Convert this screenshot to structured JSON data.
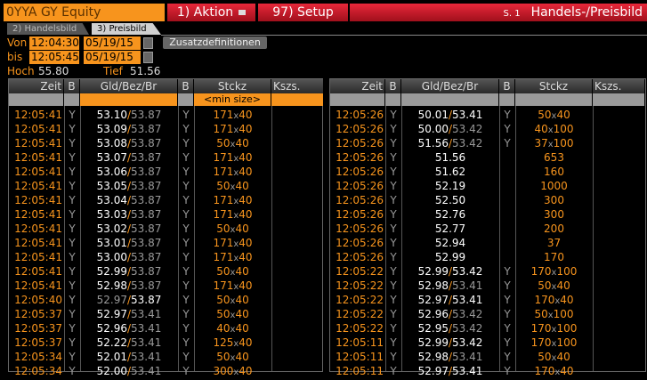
{
  "header": {
    "ticker": "0YYA GY Equity",
    "aktion": "1) Aktion",
    "setup": "97) Setup",
    "page": "S. 1",
    "title": "Handels-/Preisbild"
  },
  "tabs": [
    {
      "label": "2) Handelsbild"
    },
    {
      "label": "3) Preisbild"
    }
  ],
  "filters": {
    "von_label": "Von",
    "von_time": "12:04:30",
    "von_date": "05/19/15",
    "bis_label": "bis",
    "bis_time": "12:05:45",
    "bis_date": "05/19/15",
    "zusatz": "Zusatzdefinitionen",
    "hoch_label": "Hoch",
    "hoch": "55.80",
    "tief_label": "Tief",
    "tief": "51.56"
  },
  "columns": {
    "zeit": "Zeit",
    "b": "B",
    "gld": "Gld/Bez/Br",
    "b2": "B",
    "stckz": "Stckz",
    "kszs": "Kszs.",
    "min_size": "<min size>"
  },
  "left_rows": [
    {
      "t": "12:05:41",
      "b": "Y",
      "bid": "53.10",
      "ask": "53.87",
      "hi": "bid",
      "b2": "Y",
      "s1": "171",
      "s2": "40"
    },
    {
      "t": "12:05:41",
      "b": "Y",
      "bid": "53.09",
      "ask": "53.87",
      "hi": "bid",
      "b2": "Y",
      "s1": "171",
      "s2": "40"
    },
    {
      "t": "12:05:41",
      "b": "Y",
      "bid": "53.08",
      "ask": "53.87",
      "hi": "bid",
      "b2": "Y",
      "s1": "50",
      "s2": "40"
    },
    {
      "t": "12:05:41",
      "b": "Y",
      "bid": "53.07",
      "ask": "53.87",
      "hi": "bid",
      "b2": "Y",
      "s1": "171",
      "s2": "40"
    },
    {
      "t": "12:05:41",
      "b": "Y",
      "bid": "53.06",
      "ask": "53.87",
      "hi": "bid",
      "b2": "Y",
      "s1": "171",
      "s2": "40"
    },
    {
      "t": "12:05:41",
      "b": "Y",
      "bid": "53.05",
      "ask": "53.87",
      "hi": "bid",
      "b2": "Y",
      "s1": "50",
      "s2": "40"
    },
    {
      "t": "12:05:41",
      "b": "Y",
      "bid": "53.04",
      "ask": "53.87",
      "hi": "bid",
      "b2": "Y",
      "s1": "171",
      "s2": "40"
    },
    {
      "t": "12:05:41",
      "b": "Y",
      "bid": "53.03",
      "ask": "53.87",
      "hi": "bid",
      "b2": "Y",
      "s1": "171",
      "s2": "40"
    },
    {
      "t": "12:05:41",
      "b": "Y",
      "bid": "53.02",
      "ask": "53.87",
      "hi": "bid",
      "b2": "Y",
      "s1": "50",
      "s2": "40"
    },
    {
      "t": "12:05:41",
      "b": "Y",
      "bid": "53.01",
      "ask": "53.87",
      "hi": "bid",
      "b2": "Y",
      "s1": "171",
      "s2": "40"
    },
    {
      "t": "12:05:41",
      "b": "Y",
      "bid": "53.00",
      "ask": "53.87",
      "hi": "bid",
      "b2": "Y",
      "s1": "171",
      "s2": "40"
    },
    {
      "t": "12:05:41",
      "b": "Y",
      "bid": "52.99",
      "ask": "53.87",
      "hi": "bid",
      "b2": "Y",
      "s1": "50",
      "s2": "40"
    },
    {
      "t": "12:05:41",
      "b": "Y",
      "bid": "52.98",
      "ask": "53.87",
      "hi": "bid",
      "b2": "Y",
      "s1": "171",
      "s2": "40"
    },
    {
      "t": "12:05:40",
      "b": "Y",
      "bid": "52.97",
      "ask": "53.87",
      "hi": "ask",
      "b2": "Y",
      "s1": "50",
      "s2": "40"
    },
    {
      "t": "12:05:37",
      "b": "Y",
      "bid": "52.97",
      "ask": "53.41",
      "hi": "bid",
      "b2": "Y",
      "s1": "50",
      "s2": "40"
    },
    {
      "t": "12:05:37",
      "b": "Y",
      "bid": "52.96",
      "ask": "53.41",
      "hi": "bid",
      "b2": "Y",
      "s1": "40",
      "s2": "40"
    },
    {
      "t": "12:05:37",
      "b": "Y",
      "bid": "52.22",
      "ask": "53.41",
      "hi": "bid",
      "b2": "Y",
      "s1": "125",
      "s2": "40"
    },
    {
      "t": "12:05:34",
      "b": "Y",
      "bid": "52.01",
      "ask": "53.41",
      "hi": "bid",
      "b2": "Y",
      "s1": "50",
      "s2": "40"
    },
    {
      "t": "12:05:34",
      "b": "Y",
      "bid": "52.00",
      "ask": "53.41",
      "hi": "bid",
      "b2": "Y",
      "s1": "300",
      "s2": "40"
    }
  ],
  "right_rows": [
    {
      "t": "12:05:26",
      "b": "Y",
      "bid": "50.01",
      "ask": "53.41",
      "hi": "both",
      "b2": "Y",
      "s1": "50",
      "s2": "40"
    },
    {
      "t": "12:05:26",
      "b": "Y",
      "bid": "50.00",
      "ask": "53.42",
      "hi": "bid",
      "b2": "Y",
      "s1": "40",
      "s2": "100"
    },
    {
      "t": "12:05:26",
      "b": "Y",
      "bid": "51.56",
      "ask": "53.42",
      "hi": "bid",
      "b2": "Y",
      "s1": "37",
      "s2": "100"
    },
    {
      "t": "12:05:26",
      "b": "Y",
      "trade": "51.56",
      "s1": "653"
    },
    {
      "t": "12:05:26",
      "b": "Y",
      "trade": "51.62",
      "s1": "160"
    },
    {
      "t": "12:05:26",
      "b": "Y",
      "trade": "52.19",
      "s1": "1000"
    },
    {
      "t": "12:05:26",
      "b": "Y",
      "trade": "52.50",
      "s1": "300"
    },
    {
      "t": "12:05:26",
      "b": "Y",
      "trade": "52.76",
      "s1": "300"
    },
    {
      "t": "12:05:26",
      "b": "Y",
      "trade": "52.77",
      "s1": "200"
    },
    {
      "t": "12:05:26",
      "b": "Y",
      "trade": "52.94",
      "s1": "37"
    },
    {
      "t": "12:05:26",
      "b": "Y",
      "trade": "52.99",
      "s1": "170"
    },
    {
      "t": "12:05:22",
      "b": "Y",
      "bid": "52.99",
      "ask": "53.42",
      "hi": "both",
      "b2": "Y",
      "s1": "170",
      "s2": "100"
    },
    {
      "t": "12:05:22",
      "b": "Y",
      "bid": "52.98",
      "ask": "53.41",
      "hi": "bid",
      "b2": "Y",
      "s1": "50",
      "s2": "40"
    },
    {
      "t": "12:05:22",
      "b": "Y",
      "bid": "52.97",
      "ask": "53.41",
      "hi": "both",
      "b2": "Y",
      "s1": "170",
      "s2": "40"
    },
    {
      "t": "12:05:22",
      "b": "Y",
      "bid": "52.96",
      "ask": "53.42",
      "hi": "bid",
      "b2": "Y",
      "s1": "50",
      "s2": "100"
    },
    {
      "t": "12:05:22",
      "b": "Y",
      "bid": "52.95",
      "ask": "53.42",
      "hi": "bid",
      "b2": "Y",
      "s1": "170",
      "s2": "100"
    },
    {
      "t": "12:05:11",
      "b": "Y",
      "bid": "52.99",
      "ask": "53.42",
      "hi": "both",
      "b2": "Y",
      "s1": "170",
      "s2": "100"
    },
    {
      "t": "12:05:11",
      "b": "Y",
      "bid": "52.98",
      "ask": "53.41",
      "hi": "bid",
      "b2": "Y",
      "s1": "50",
      "s2": "40"
    },
    {
      "t": "12:05:11",
      "b": "Y",
      "bid": "52.97",
      "ask": "53.41",
      "hi": "both",
      "b2": "Y",
      "s1": "170",
      "s2": "40"
    }
  ]
}
